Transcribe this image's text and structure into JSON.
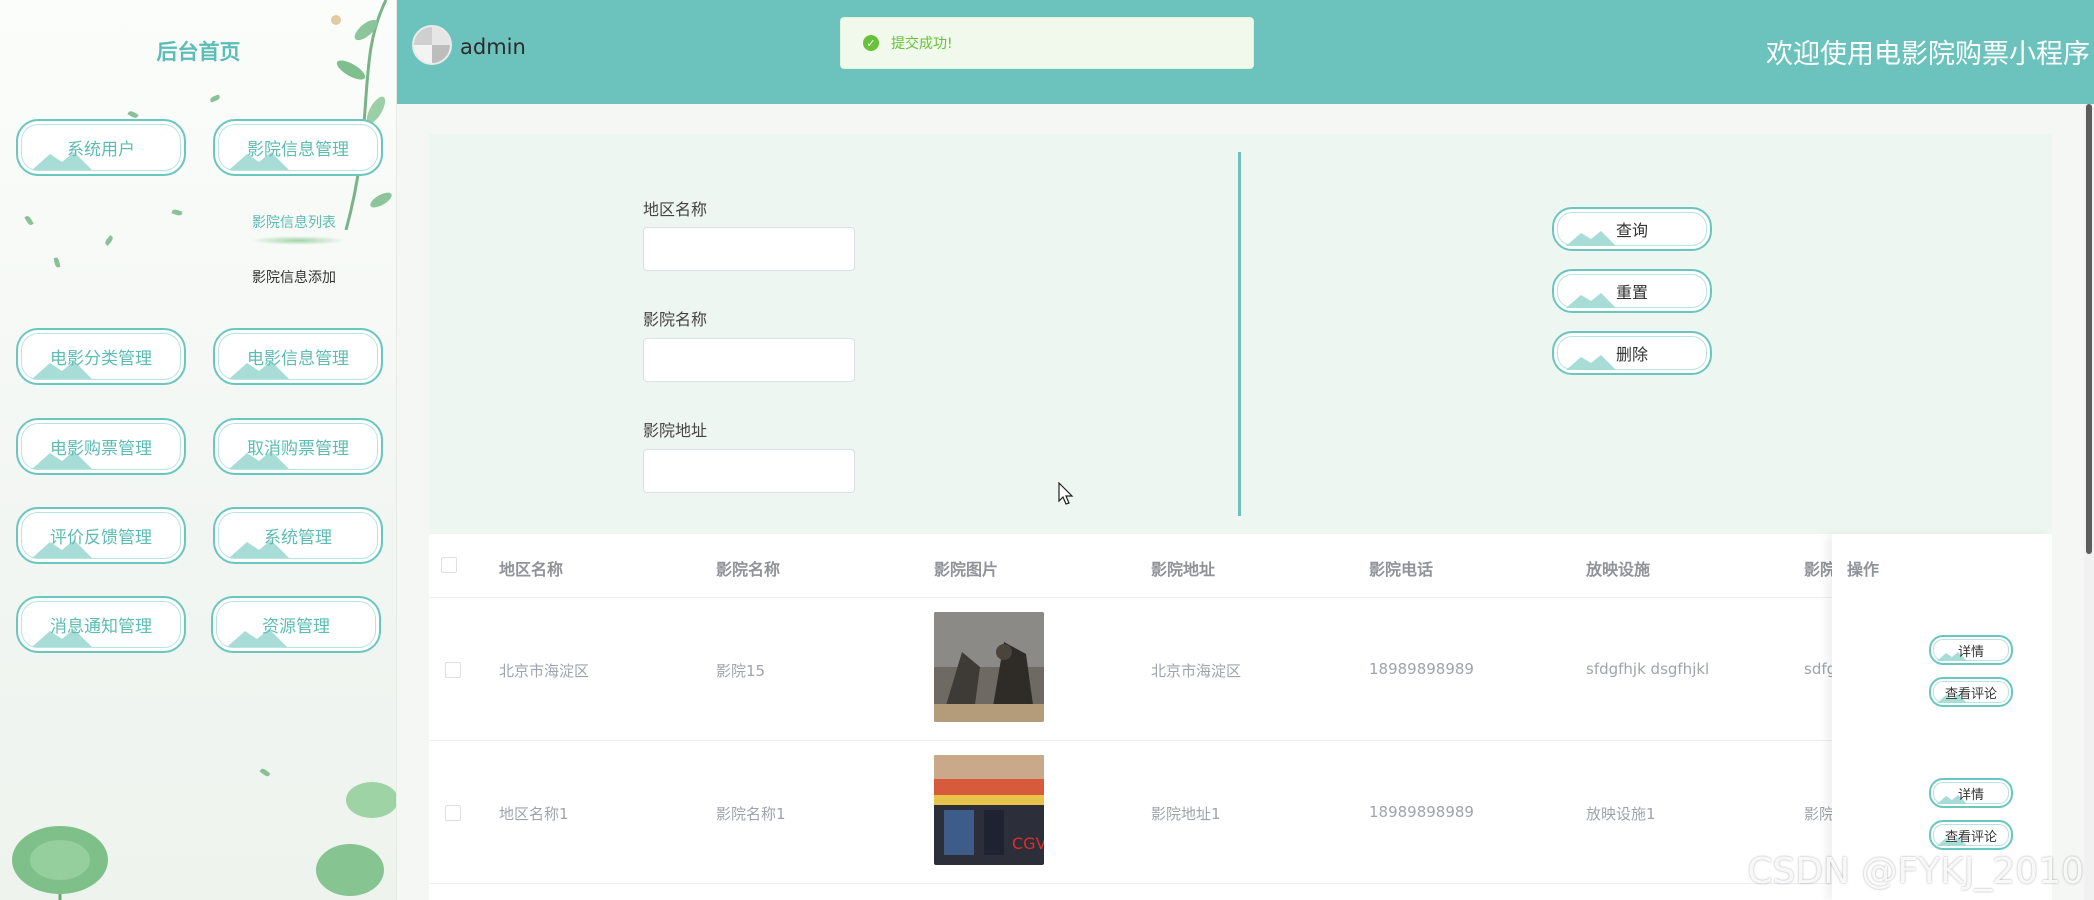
{
  "sidebar": {
    "title": "后台首页",
    "menu": [
      {
        "label": "系统用户"
      },
      {
        "label": "影院信息管理"
      },
      {
        "label": "电影分类管理"
      },
      {
        "label": "电影信息管理"
      },
      {
        "label": "电影购票管理"
      },
      {
        "label": "取消购票管理"
      },
      {
        "label": "评价反馈管理"
      },
      {
        "label": "系统管理"
      },
      {
        "label": "消息通知管理"
      },
      {
        "label": "资源管理"
      }
    ],
    "submenu": [
      {
        "label": "影院信息列表",
        "active": true
      },
      {
        "label": "影院信息添加",
        "active": false
      }
    ]
  },
  "header": {
    "username": "admin",
    "welcome": "欢迎使用电影院购票小程序",
    "toast": "提交成功!"
  },
  "search": {
    "fields": [
      {
        "label": "地区名称",
        "value": "",
        "placeholder": ""
      },
      {
        "label": "影院名称",
        "value": "",
        "placeholder": ""
      },
      {
        "label": "影院地址",
        "value": "",
        "placeholder": ""
      }
    ],
    "buttons": {
      "query": "查询",
      "reset": "重置",
      "delete": "删除"
    }
  },
  "table": {
    "columns": [
      "地区名称",
      "影院名称",
      "影院图片",
      "影院地址",
      "影院电话",
      "放映设施",
      "影院",
      "操作"
    ],
    "rows": [
      {
        "region": "北京市海淀区",
        "name": "影院15",
        "address": "北京市海淀区",
        "phone": "18989898989",
        "facility": "sfdgfhjk dsgfhjkl",
        "extra": "sdfg",
        "poster": "monster-poster"
      },
      {
        "region": "地区名称1",
        "name": "影院名称1",
        "address": "影院地址1",
        "phone": "18989898989",
        "facility": "放映设施1",
        "extra": "影院",
        "poster": "cinema-storefront"
      }
    ],
    "actions": {
      "detail": "详情",
      "comments": "查看评论"
    }
  },
  "watermark": "CSDN @FYKJ_2010",
  "colors": {
    "accent": "#6cc2bd",
    "header": "#6cc2bd",
    "toast_bg": "#f0f9eb",
    "toast_text": "#67c23a"
  }
}
